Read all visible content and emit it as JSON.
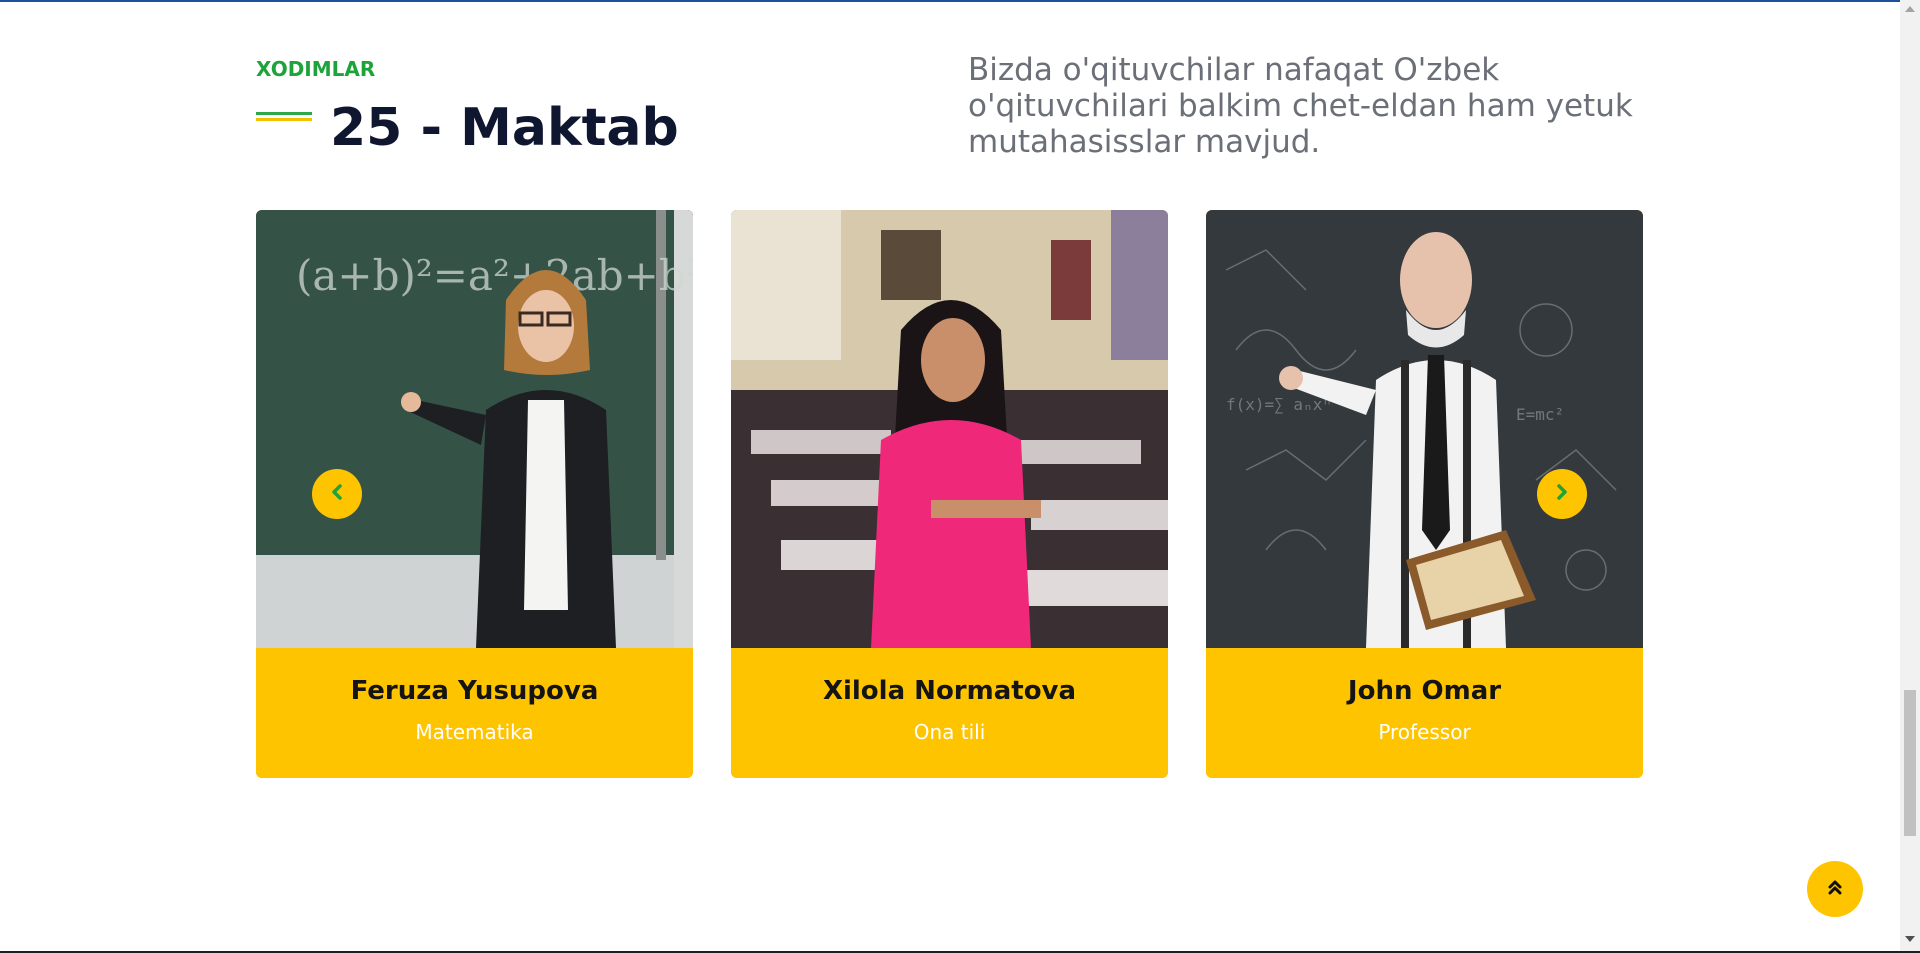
{
  "section": {
    "eyebrow": "XODIMLAR",
    "title": "25 - Maktab",
    "intro": "Bizda o'qituvchilar nafaqat O'zbek o'qituvchilari balkim chet-eldan ham yetuk mutahasisslar mavjud."
  },
  "staff": [
    {
      "name": "Feruza Yusupova",
      "role": "Matematika",
      "photo_icon": "teacher-at-chalkboard-photo"
    },
    {
      "name": "Xilola Normatova",
      "role": "Ona tili",
      "photo_icon": "teacher-in-classroom-photo"
    },
    {
      "name": "John Omar",
      "role": "Professor",
      "photo_icon": "professor-with-book-photo"
    }
  ],
  "carousel": {
    "prev_icon": "chevron-left-icon",
    "next_icon": "chevron-right-icon"
  },
  "back_to_top": {
    "icon": "double-chevron-up-icon"
  },
  "colors": {
    "accent_yellow": "#ffc400",
    "accent_green": "#1ea33b",
    "heading": "#0e1630",
    "muted_text": "#6b6f77"
  }
}
